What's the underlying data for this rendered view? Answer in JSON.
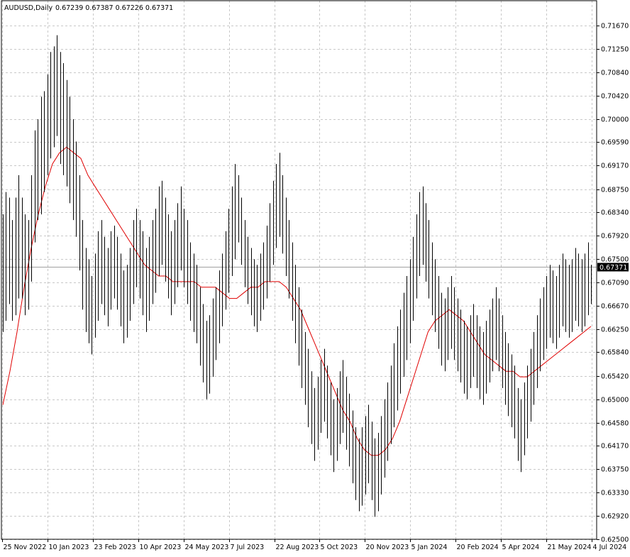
{
  "header": {
    "symbol": "AUDUSD,Daily",
    "ohlc": "0.67239 0.67387 0.67226 0.67371"
  },
  "chart_data": {
    "type": "ohlc_bar",
    "symbol": "AUDUSD",
    "timeframe": "Daily",
    "last_price_label": "0.67371",
    "ylim": [
      0.625,
      0.719
    ],
    "y_ticks": [
      0.625,
      0.6292,
      0.6333,
      0.6375,
      0.6417,
      0.6458,
      0.65,
      0.6542,
      0.6584,
      0.6625,
      0.6667,
      0.6709,
      0.675,
      0.6792,
      0.6834,
      0.6875,
      0.6917,
      0.6959,
      0.7,
      0.7042,
      0.7084,
      0.7125,
      0.7167
    ],
    "y_tick_labels": [
      "0.62500",
      "0.62920",
      "0.63330",
      "0.63750",
      "0.64170",
      "0.64580",
      "0.65000",
      "0.65420",
      "0.65840",
      "0.66250",
      "0.66670",
      "0.67090",
      "0.67500",
      "0.67920",
      "0.68340",
      "0.68750",
      "0.69170",
      "0.69590",
      "0.70000",
      "0.70420",
      "0.70840",
      "0.71250",
      "0.71670"
    ],
    "x_tick_labels": [
      "25 Nov 2022",
      "10 Jan 2023",
      "23 Feb 2023",
      "10 Apr 2023",
      "24 May 2023",
      "7 Jul 2023",
      "22 Aug 2023",
      "5 Oct 2023",
      "20 Nov 2023",
      "5 Jan 2024",
      "20 Feb 2024",
      "5 Apr 2024",
      "21 May 2024",
      "4 Jul 2024"
    ],
    "grid": true,
    "price_series": [
      [
        0.662,
        0.683
      ],
      [
        0.664,
        0.687
      ],
      [
        0.667,
        0.686
      ],
      [
        0.664,
        0.682
      ],
      [
        0.665,
        0.686
      ],
      [
        0.668,
        0.69
      ],
      [
        0.668,
        0.686
      ],
      [
        0.665,
        0.683
      ],
      [
        0.666,
        0.682
      ],
      [
        0.671,
        0.69
      ],
      [
        0.678,
        0.698
      ],
      [
        0.682,
        0.7
      ],
      [
        0.683,
        0.704
      ],
      [
        0.687,
        0.705
      ],
      [
        0.69,
        0.708
      ],
      [
        0.693,
        0.712
      ],
      [
        0.695,
        0.713
      ],
      [
        0.697,
        0.715
      ],
      [
        0.692,
        0.712
      ],
      [
        0.69,
        0.71
      ],
      [
        0.688,
        0.707
      ],
      [
        0.685,
        0.704
      ],
      [
        0.682,
        0.7
      ],
      [
        0.679,
        0.696
      ],
      [
        0.673,
        0.69
      ],
      [
        0.666,
        0.682
      ],
      [
        0.662,
        0.677
      ],
      [
        0.66,
        0.675
      ],
      [
        0.658,
        0.672
      ],
      [
        0.661,
        0.676
      ],
      [
        0.664,
        0.68
      ],
      [
        0.667,
        0.682
      ],
      [
        0.665,
        0.679
      ],
      [
        0.663,
        0.677
      ],
      [
        0.666,
        0.68
      ],
      [
        0.668,
        0.681
      ],
      [
        0.666,
        0.679
      ],
      [
        0.663,
        0.676
      ],
      [
        0.66,
        0.673
      ],
      [
        0.661,
        0.674
      ],
      [
        0.664,
        0.677
      ],
      [
        0.667,
        0.682
      ],
      [
        0.67,
        0.684
      ],
      [
        0.668,
        0.682
      ],
      [
        0.665,
        0.68
      ],
      [
        0.662,
        0.677
      ],
      [
        0.664,
        0.679
      ],
      [
        0.667,
        0.682
      ],
      [
        0.669,
        0.684
      ],
      [
        0.672,
        0.688
      ],
      [
        0.674,
        0.689
      ],
      [
        0.671,
        0.686
      ],
      [
        0.668,
        0.683
      ],
      [
        0.665,
        0.68
      ],
      [
        0.667,
        0.682
      ],
      [
        0.67,
        0.685
      ],
      [
        0.673,
        0.688
      ],
      [
        0.67,
        0.684
      ],
      [
        0.667,
        0.682
      ],
      [
        0.664,
        0.678
      ],
      [
        0.662,
        0.676
      ],
      [
        0.66,
        0.674
      ],
      [
        0.656,
        0.67
      ],
      [
        0.653,
        0.667
      ],
      [
        0.65,
        0.664
      ],
      [
        0.651,
        0.665
      ],
      [
        0.654,
        0.668
      ],
      [
        0.657,
        0.67
      ],
      [
        0.66,
        0.673
      ],
      [
        0.663,
        0.676
      ],
      [
        0.666,
        0.68
      ],
      [
        0.669,
        0.684
      ],
      [
        0.672,
        0.688
      ],
      [
        0.675,
        0.692
      ],
      [
        0.678,
        0.69
      ],
      [
        0.674,
        0.686
      ],
      [
        0.67,
        0.682
      ],
      [
        0.667,
        0.679
      ],
      [
        0.665,
        0.677
      ],
      [
        0.663,
        0.675
      ],
      [
        0.662,
        0.674
      ],
      [
        0.664,
        0.676
      ],
      [
        0.666,
        0.678
      ],
      [
        0.668,
        0.681
      ],
      [
        0.671,
        0.685
      ],
      [
        0.674,
        0.689
      ],
      [
        0.677,
        0.692
      ],
      [
        0.679,
        0.694
      ],
      [
        0.676,
        0.69
      ],
      [
        0.672,
        0.686
      ],
      [
        0.668,
        0.682
      ],
      [
        0.664,
        0.678
      ],
      [
        0.66,
        0.674
      ],
      [
        0.656,
        0.67
      ],
      [
        0.652,
        0.666
      ],
      [
        0.649,
        0.662
      ],
      [
        0.645,
        0.659
      ],
      [
        0.642,
        0.655
      ],
      [
        0.639,
        0.652
      ],
      [
        0.641,
        0.654
      ],
      [
        0.644,
        0.657
      ],
      [
        0.646,
        0.659
      ],
      [
        0.643,
        0.656
      ],
      [
        0.64,
        0.653
      ],
      [
        0.637,
        0.65
      ],
      [
        0.639,
        0.652
      ],
      [
        0.642,
        0.655
      ],
      [
        0.644,
        0.657
      ],
      [
        0.641,
        0.654
      ],
      [
        0.638,
        0.651
      ],
      [
        0.635,
        0.648
      ],
      [
        0.632,
        0.645
      ],
      [
        0.63,
        0.643
      ],
      [
        0.631,
        0.645
      ],
      [
        0.633,
        0.647
      ],
      [
        0.635,
        0.649
      ],
      [
        0.632,
        0.646
      ],
      [
        0.629,
        0.643
      ],
      [
        0.63,
        0.644
      ],
      [
        0.633,
        0.647
      ],
      [
        0.636,
        0.65
      ],
      [
        0.639,
        0.653
      ],
      [
        0.642,
        0.656
      ],
      [
        0.645,
        0.66
      ],
      [
        0.648,
        0.663
      ],
      [
        0.651,
        0.666
      ],
      [
        0.654,
        0.669
      ],
      [
        0.657,
        0.672
      ],
      [
        0.66,
        0.675
      ],
      [
        0.664,
        0.679
      ],
      [
        0.668,
        0.683
      ],
      [
        0.672,
        0.687
      ],
      [
        0.674,
        0.688
      ],
      [
        0.671,
        0.685
      ],
      [
        0.668,
        0.682
      ],
      [
        0.665,
        0.678
      ],
      [
        0.662,
        0.675
      ],
      [
        0.659,
        0.672
      ],
      [
        0.656,
        0.669
      ],
      [
        0.655,
        0.668
      ],
      [
        0.657,
        0.67
      ],
      [
        0.659,
        0.672
      ],
      [
        0.657,
        0.67
      ],
      [
        0.655,
        0.668
      ],
      [
        0.653,
        0.666
      ],
      [
        0.651,
        0.664
      ],
      [
        0.65,
        0.663
      ],
      [
        0.652,
        0.665
      ],
      [
        0.654,
        0.667
      ],
      [
        0.652,
        0.665
      ],
      [
        0.65,
        0.663
      ],
      [
        0.649,
        0.662
      ],
      [
        0.651,
        0.664
      ],
      [
        0.653,
        0.666
      ],
      [
        0.655,
        0.668
      ],
      [
        0.657,
        0.67
      ],
      [
        0.655,
        0.668
      ],
      [
        0.652,
        0.665
      ],
      [
        0.649,
        0.662
      ],
      [
        0.647,
        0.66
      ],
      [
        0.645,
        0.658
      ],
      [
        0.643,
        0.656
      ],
      [
        0.639,
        0.652
      ],
      [
        0.637,
        0.65
      ],
      [
        0.64,
        0.653
      ],
      [
        0.643,
        0.656
      ],
      [
        0.646,
        0.659
      ],
      [
        0.649,
        0.662
      ],
      [
        0.652,
        0.665
      ],
      [
        0.655,
        0.668
      ],
      [
        0.657,
        0.67
      ],
      [
        0.659,
        0.672
      ],
      [
        0.661,
        0.674
      ],
      [
        0.66,
        0.673
      ],
      [
        0.659,
        0.672
      ],
      [
        0.661,
        0.674
      ],
      [
        0.663,
        0.676
      ],
      [
        0.662,
        0.675
      ],
      [
        0.661,
        0.674
      ],
      [
        0.662,
        0.675
      ],
      [
        0.664,
        0.677
      ],
      [
        0.663,
        0.676
      ],
      [
        0.662,
        0.675
      ],
      [
        0.663,
        0.676
      ],
      [
        0.665,
        0.678
      ],
      [
        0.667,
        0.674
      ]
    ],
    "moving_average": [
      0.649,
      0.655,
      0.662,
      0.67,
      0.677,
      0.683,
      0.688,
      0.692,
      0.694,
      0.695,
      0.694,
      0.693,
      0.69,
      0.688,
      0.686,
      0.684,
      0.682,
      0.68,
      0.678,
      0.676,
      0.674,
      0.673,
      0.672,
      0.672,
      0.671,
      0.671,
      0.671,
      0.671,
      0.67,
      0.67,
      0.67,
      0.669,
      0.668,
      0.668,
      0.669,
      0.67,
      0.67,
      0.671,
      0.671,
      0.671,
      0.67,
      0.668,
      0.666,
      0.663,
      0.66,
      0.657,
      0.654,
      0.651,
      0.648,
      0.646,
      0.643,
      0.641,
      0.64,
      0.64,
      0.641,
      0.643,
      0.646,
      0.65,
      0.654,
      0.658,
      0.662,
      0.664,
      0.665,
      0.666,
      0.665,
      0.664,
      0.662,
      0.66,
      0.658,
      0.657,
      0.656,
      0.655,
      0.655,
      0.654,
      0.654,
      0.655,
      0.656,
      0.657,
      0.658,
      0.659,
      0.66,
      0.661,
      0.662,
      0.663
    ]
  }
}
